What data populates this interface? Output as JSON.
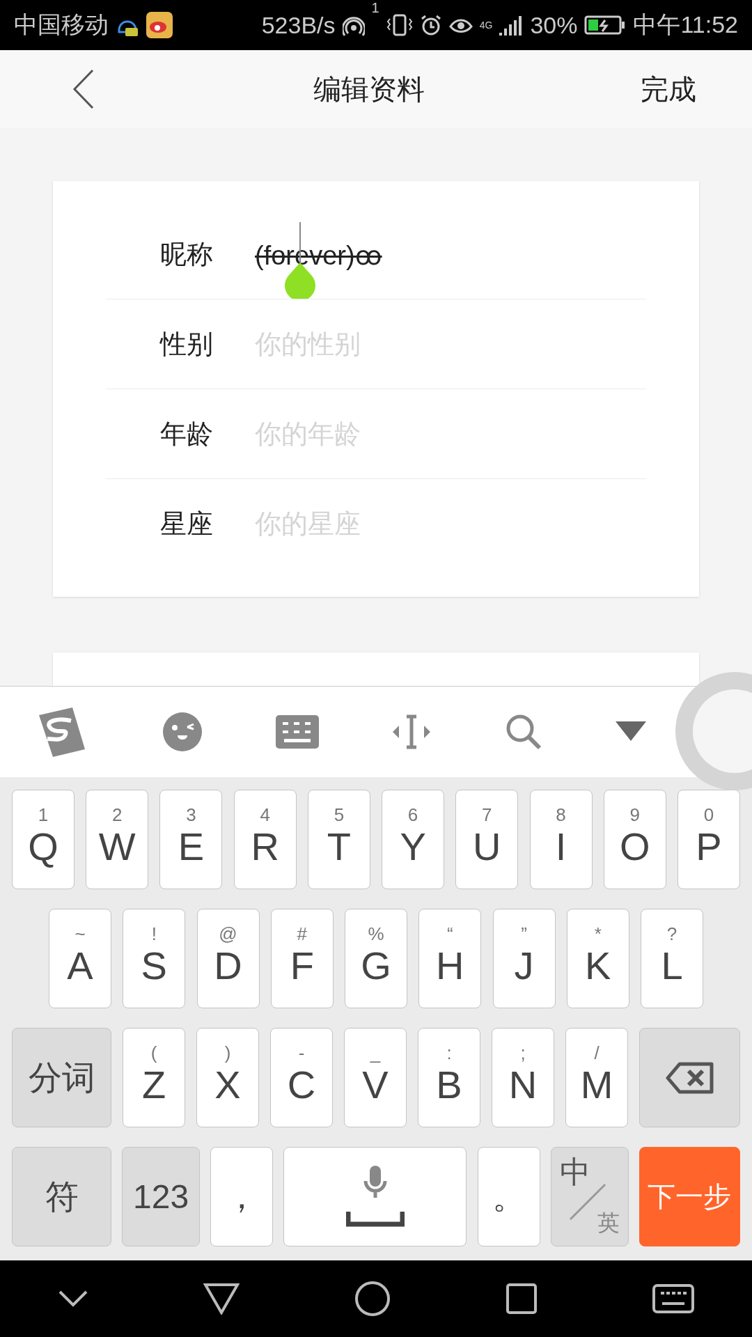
{
  "status_bar": {
    "carrier": "中国移动",
    "speed": "523B/s",
    "hotspot_count": "1",
    "network": "4G",
    "battery": "30%",
    "time": "中午11:52"
  },
  "header": {
    "title": "编辑资料",
    "done": "完成"
  },
  "profile_fields": [
    {
      "label": "昵称",
      "value": "(forever)ꝏ",
      "strikethrough": true,
      "focused": true
    },
    {
      "label": "性别",
      "placeholder": "你的性别",
      "focused": false
    },
    {
      "label": "年龄",
      "placeholder": "你的年龄",
      "focused": false
    },
    {
      "label": "星座",
      "placeholder": "你的星座",
      "focused": false
    }
  ],
  "keyboard": {
    "rows": [
      {
        "keys": [
          {
            "kind": "letter",
            "label": "Q",
            "hint": "1"
          },
          {
            "kind": "letter",
            "label": "W",
            "hint": "2"
          },
          {
            "kind": "letter",
            "label": "E",
            "hint": "3"
          },
          {
            "kind": "letter",
            "label": "R",
            "hint": "4"
          },
          {
            "kind": "letter",
            "label": "T",
            "hint": "5"
          },
          {
            "kind": "letter",
            "label": "Y",
            "hint": "6"
          },
          {
            "kind": "letter",
            "label": "U",
            "hint": "7"
          },
          {
            "kind": "letter",
            "label": "I",
            "hint": "8"
          },
          {
            "kind": "letter",
            "label": "O",
            "hint": "9"
          },
          {
            "kind": "letter",
            "label": "P",
            "hint": "0"
          }
        ]
      },
      {
        "keys": [
          {
            "kind": "letter",
            "label": "A",
            "hint": "~"
          },
          {
            "kind": "letter",
            "label": "S",
            "hint": "!"
          },
          {
            "kind": "letter",
            "label": "D",
            "hint": "@"
          },
          {
            "kind": "letter",
            "label": "F",
            "hint": "#"
          },
          {
            "kind": "letter",
            "label": "G",
            "hint": "%"
          },
          {
            "kind": "letter",
            "label": "H",
            "hint": "“"
          },
          {
            "kind": "letter",
            "label": "J",
            "hint": "”"
          },
          {
            "kind": "letter",
            "label": "K",
            "hint": "*"
          },
          {
            "kind": "letter",
            "label": "L",
            "hint": "?"
          }
        ]
      },
      {
        "keys": [
          {
            "kind": "wide",
            "label": "分词"
          },
          {
            "kind": "letter",
            "label": "Z",
            "hint": "("
          },
          {
            "kind": "letter",
            "label": "X",
            "hint": ")"
          },
          {
            "kind": "letter",
            "label": "C",
            "hint": "-"
          },
          {
            "kind": "letter",
            "label": "V",
            "hint": "_"
          },
          {
            "kind": "letter",
            "label": "B",
            "hint": ":"
          },
          {
            "kind": "letter",
            "label": "N",
            "hint": ";"
          },
          {
            "kind": "letter",
            "label": "M",
            "hint": "/"
          },
          {
            "kind": "delete"
          }
        ]
      },
      {
        "keys": [
          {
            "kind": "wide",
            "label": "符"
          },
          {
            "kind": "function",
            "label": "123"
          },
          {
            "kind": "punct",
            "label": "，"
          },
          {
            "kind": "space"
          },
          {
            "kind": "punct",
            "label": "。"
          },
          {
            "kind": "lang",
            "label": "中",
            "alt": "英"
          },
          {
            "kind": "action",
            "label": "下一步"
          }
        ]
      }
    ]
  }
}
